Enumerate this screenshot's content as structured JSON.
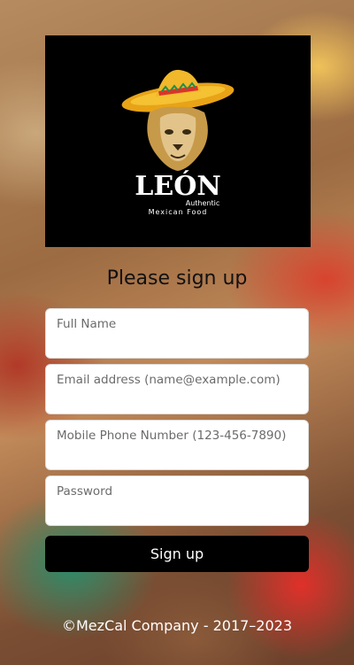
{
  "brand": {
    "name": "LEÓN",
    "tagline_1": "Authentic",
    "tagline_2": "Mexican Food"
  },
  "form": {
    "title": "Please sign up",
    "fields": [
      {
        "label": "Full Name"
      },
      {
        "label": "Email address (name@example.com)"
      },
      {
        "label": "Mobile Phone Number (123-456-7890)"
      },
      {
        "label": "Password"
      }
    ],
    "submit_label": "Sign up"
  },
  "footer": {
    "copyright": "©MezCal Company - 2017–2023"
  }
}
